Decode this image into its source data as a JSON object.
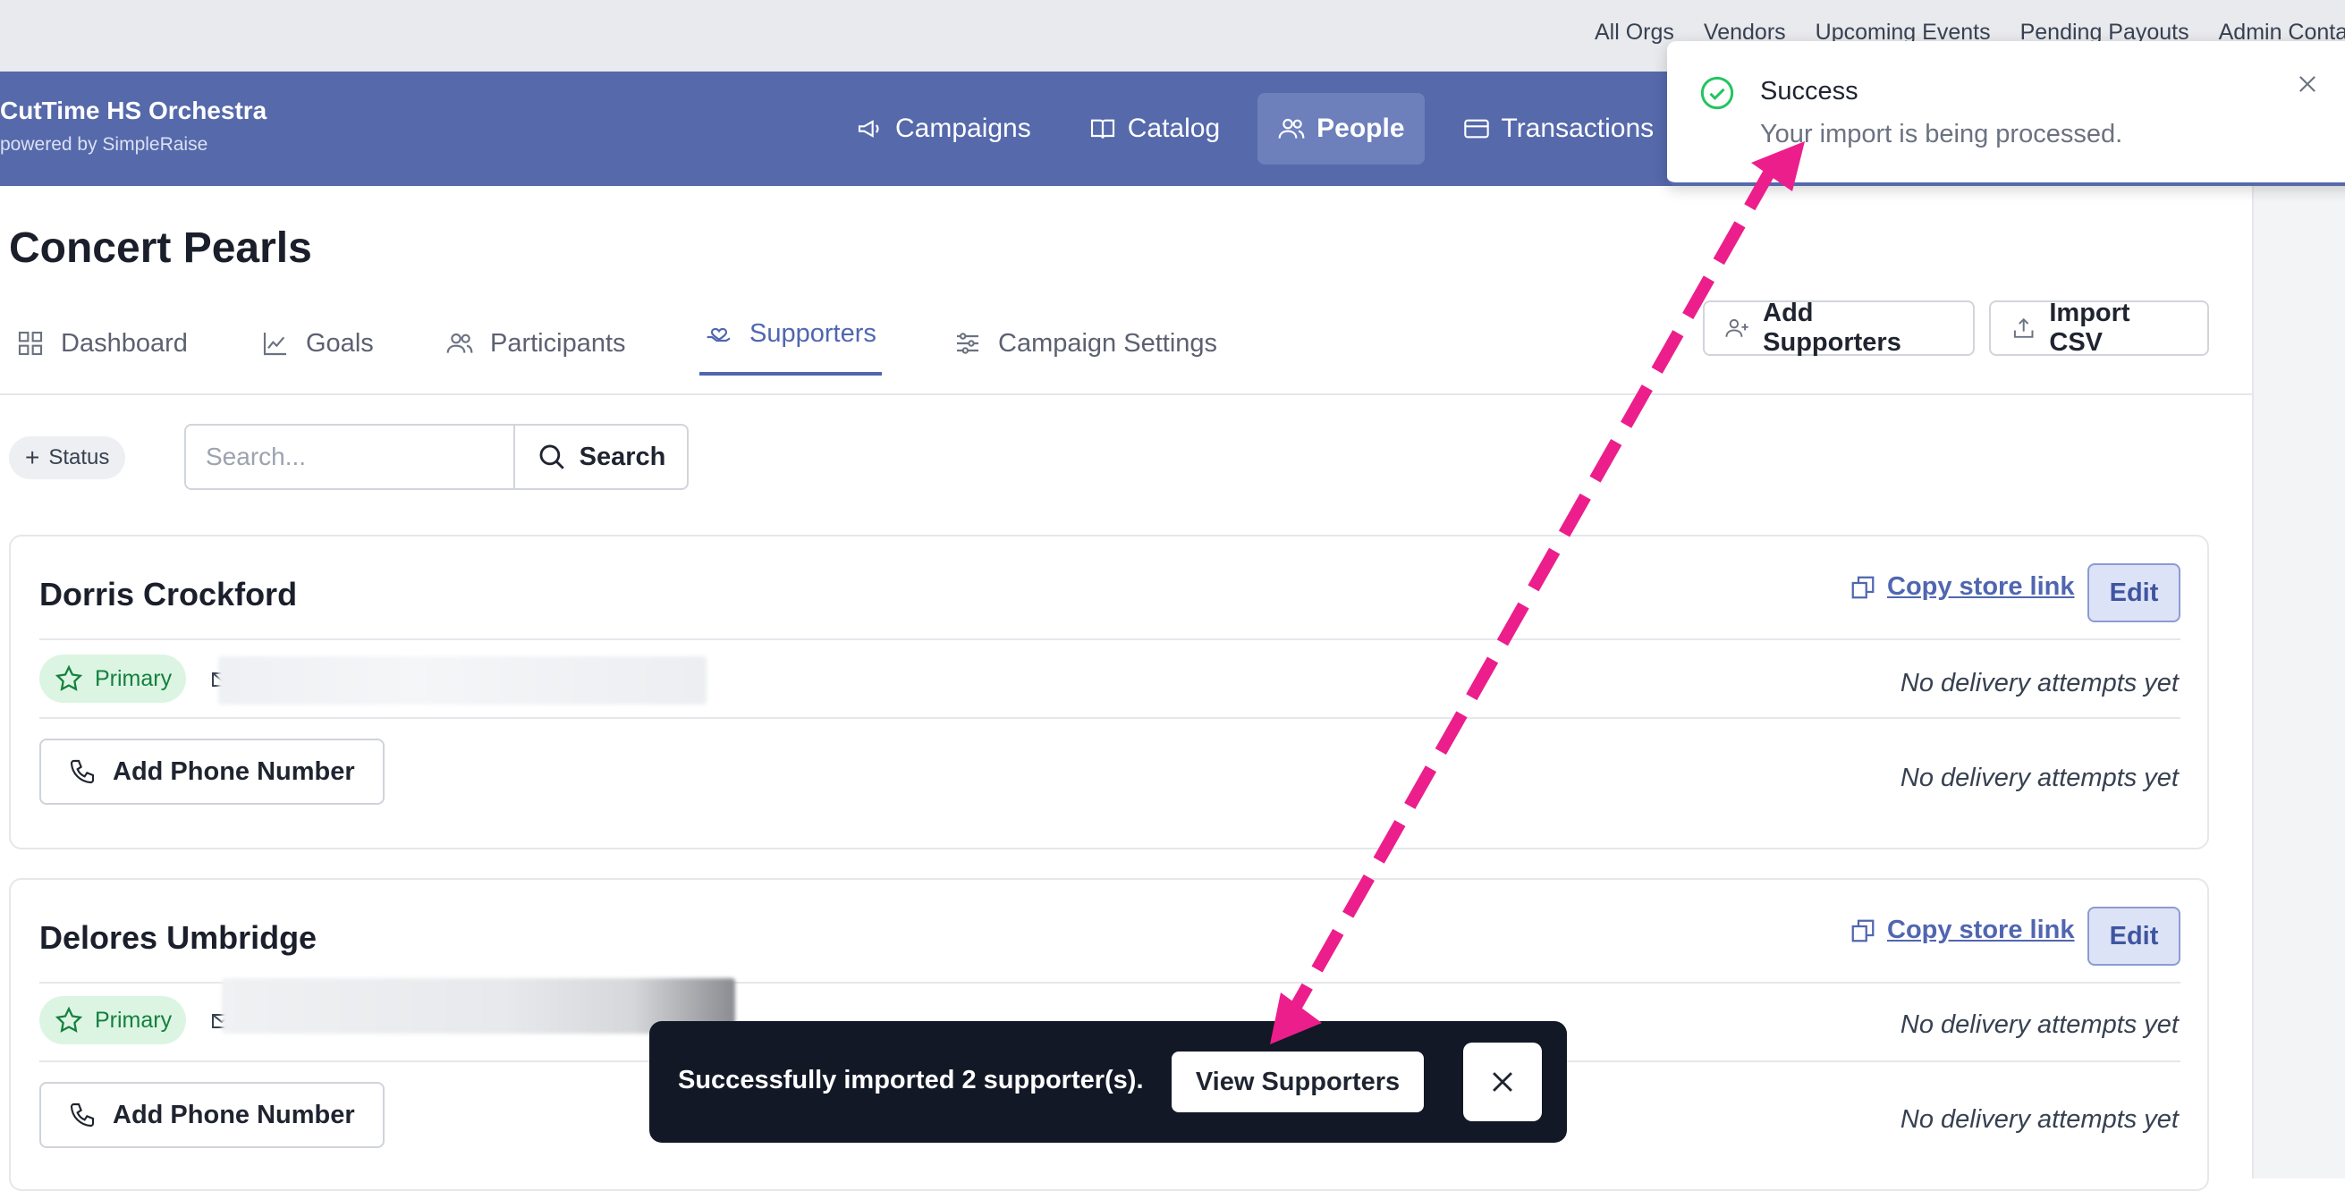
{
  "top_links": [
    "All Orgs",
    "Vendors",
    "Upcoming Events",
    "Pending Payouts",
    "Admin Conta"
  ],
  "org": {
    "name": "CutTime HS Orchestra",
    "powered_by": "powered by SimpleRaise"
  },
  "main_nav": [
    {
      "label": "Campaigns",
      "icon": "megaphone-icon"
    },
    {
      "label": "Catalog",
      "icon": "book-icon"
    },
    {
      "label": "People",
      "icon": "users-icon",
      "active": true
    },
    {
      "label": "Transactions",
      "icon": "card-icon"
    }
  ],
  "page": {
    "title": "Concert Pearls"
  },
  "tabs": [
    {
      "label": "Dashboard",
      "icon": "grid-icon"
    },
    {
      "label": "Goals",
      "icon": "chart-line-icon"
    },
    {
      "label": "Participants",
      "icon": "users-icon"
    },
    {
      "label": "Supporters",
      "icon": "heart-hand-icon",
      "active": true
    },
    {
      "label": "Campaign Settings",
      "icon": "sliders-icon"
    }
  ],
  "actions": {
    "add_supporters": "Add Supporters",
    "import_csv": "Import CSV"
  },
  "filters": {
    "status_label": "Status",
    "search_placeholder": "Search...",
    "search_button": "Search"
  },
  "supporters": [
    {
      "name": "Dorris Crockford",
      "copy_link": "Copy store link",
      "edit": "Edit",
      "badge": "Primary",
      "email_status": "No delivery attempts yet",
      "phone_button": "Add Phone Number",
      "phone_status": "No delivery attempts yet"
    },
    {
      "name": "Delores Umbridge",
      "copy_link": "Copy store link",
      "edit": "Edit",
      "badge": "Primary",
      "email_status": "No delivery attempts yet",
      "phone_button": "Add Phone Number",
      "phone_status": "No delivery attempts yet"
    }
  ],
  "toast": {
    "title": "Success",
    "message": "Your import is being processed."
  },
  "snackbar": {
    "text": "Successfully imported 2 supporter(s).",
    "button": "View Supporters"
  },
  "colors": {
    "header": "#5569ab",
    "accent": "#5066b0",
    "annotation": "#ec1e8c",
    "success": "#22c55e"
  }
}
